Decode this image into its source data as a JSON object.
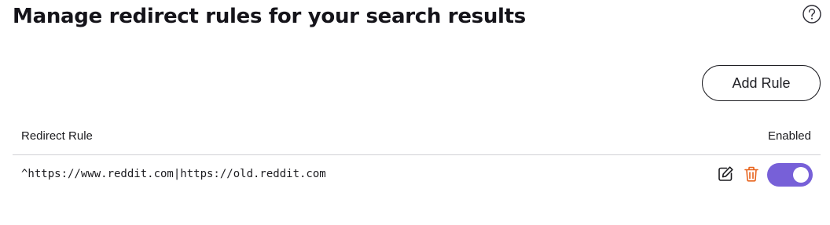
{
  "header": {
    "title": "Manage redirect rules for your search results",
    "help_icon": "help-circle-icon"
  },
  "toolbar": {
    "add_rule_label": "Add Rule"
  },
  "table": {
    "columns": [
      "Redirect Rule",
      "Enabled"
    ],
    "rows": [
      {
        "rule": "^https://www.reddit.com|https://old.reddit.com",
        "enabled": true,
        "actions": [
          "edit-icon",
          "trash-icon"
        ]
      }
    ]
  },
  "colors": {
    "accent": "#7760d8",
    "delete": "#e8631c",
    "text": "#1b1b1f"
  }
}
